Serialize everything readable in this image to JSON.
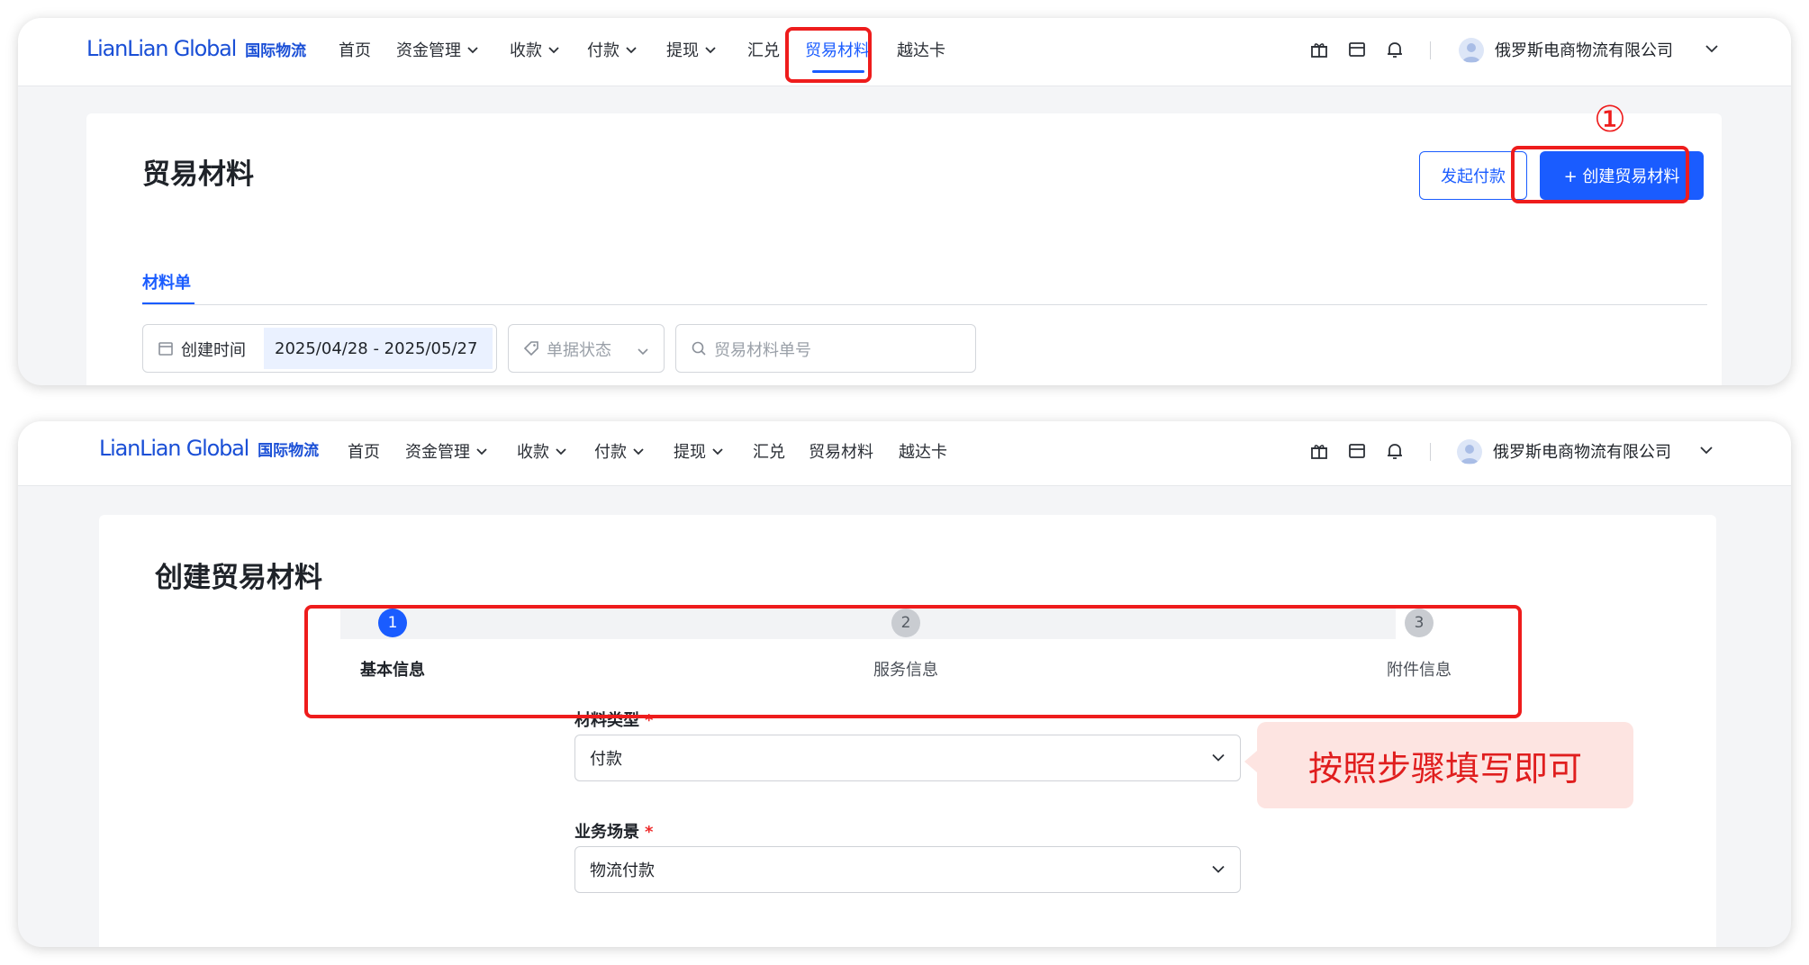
{
  "brand": {
    "logo_text": "LianLian Global",
    "logo_cn": "国际物流",
    "accent": "#1a5cff",
    "annotation_red": "#ee1c1c"
  },
  "nav": {
    "items": [
      {
        "label": "首页",
        "has_dropdown": false
      },
      {
        "label": "资金管理",
        "has_dropdown": true
      },
      {
        "label": "收款",
        "has_dropdown": true
      },
      {
        "label": "付款",
        "has_dropdown": true
      },
      {
        "label": "提现",
        "has_dropdown": true
      },
      {
        "label": "汇兑",
        "has_dropdown": false
      },
      {
        "label": "贸易材料",
        "has_dropdown": false
      },
      {
        "label": "越达卡",
        "has_dropdown": false
      }
    ],
    "icons": [
      "gift-icon",
      "wallet-icon",
      "bell-icon"
    ],
    "company": "俄罗斯电商物流有限公司"
  },
  "screen1": {
    "active_nav": "贸易材料",
    "title": "贸易材料",
    "initiate_payment": "发起付款",
    "create_button": "+ 创建贸易材料",
    "annotation_number": "①",
    "tab": "材料单",
    "filters": {
      "date_label": "创建时间",
      "date_range": "2025/04/28 - 2025/05/27",
      "status_placeholder": "单据状态",
      "search_placeholder": "贸易材料单号"
    }
  },
  "screen2": {
    "title": "创建贸易材料",
    "steps": [
      {
        "number": "1",
        "label": "基本信息",
        "state": "current"
      },
      {
        "number": "2",
        "label": "服务信息",
        "state": "pending"
      },
      {
        "number": "3",
        "label": "附件信息",
        "state": "pending"
      }
    ],
    "fields": [
      {
        "label": "材料类型",
        "required": "*",
        "value": "付款"
      },
      {
        "label": "业务场景",
        "required": "*",
        "value": "物流付款"
      }
    ],
    "callout": "按照步骤填写即可"
  }
}
